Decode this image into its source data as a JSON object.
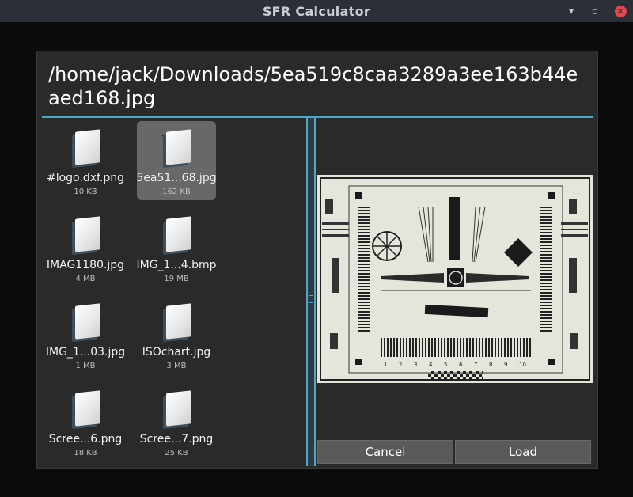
{
  "window": {
    "title": "SFR Calculator"
  },
  "dialog": {
    "path": "/home/jack/Downloads/5ea519c8caa3289a3ee163b44eaed168.jpg",
    "files": [
      {
        "name": "#logo.dxf.png",
        "size": "10 KB",
        "selected": false
      },
      {
        "name": "5ea51...68.jpg",
        "size": "162 KB",
        "selected": true
      },
      {
        "name": "IMAG1180.jpg",
        "size": "4 MB",
        "selected": false
      },
      {
        "name": "IMG_1...4.bmp",
        "size": "19 MB",
        "selected": false
      },
      {
        "name": "IMG_1...03.jpg",
        "size": "1 MB",
        "selected": false
      },
      {
        "name": "ISOchart.jpg",
        "size": "3 MB",
        "selected": false
      },
      {
        "name": "Scree...6.png",
        "size": "18 KB",
        "selected": false
      },
      {
        "name": "Scree...7.png",
        "size": "25 KB",
        "selected": false
      }
    ],
    "buttons": {
      "cancel": "Cancel",
      "load": "Load"
    },
    "preview_scale_labels": [
      "1",
      "2",
      "3",
      "4",
      "5",
      "6",
      "7",
      "8",
      "9",
      "10"
    ]
  },
  "colors": {
    "accent": "#4ea8c8",
    "close": "#e3464d",
    "selected_tile": "#686868"
  }
}
